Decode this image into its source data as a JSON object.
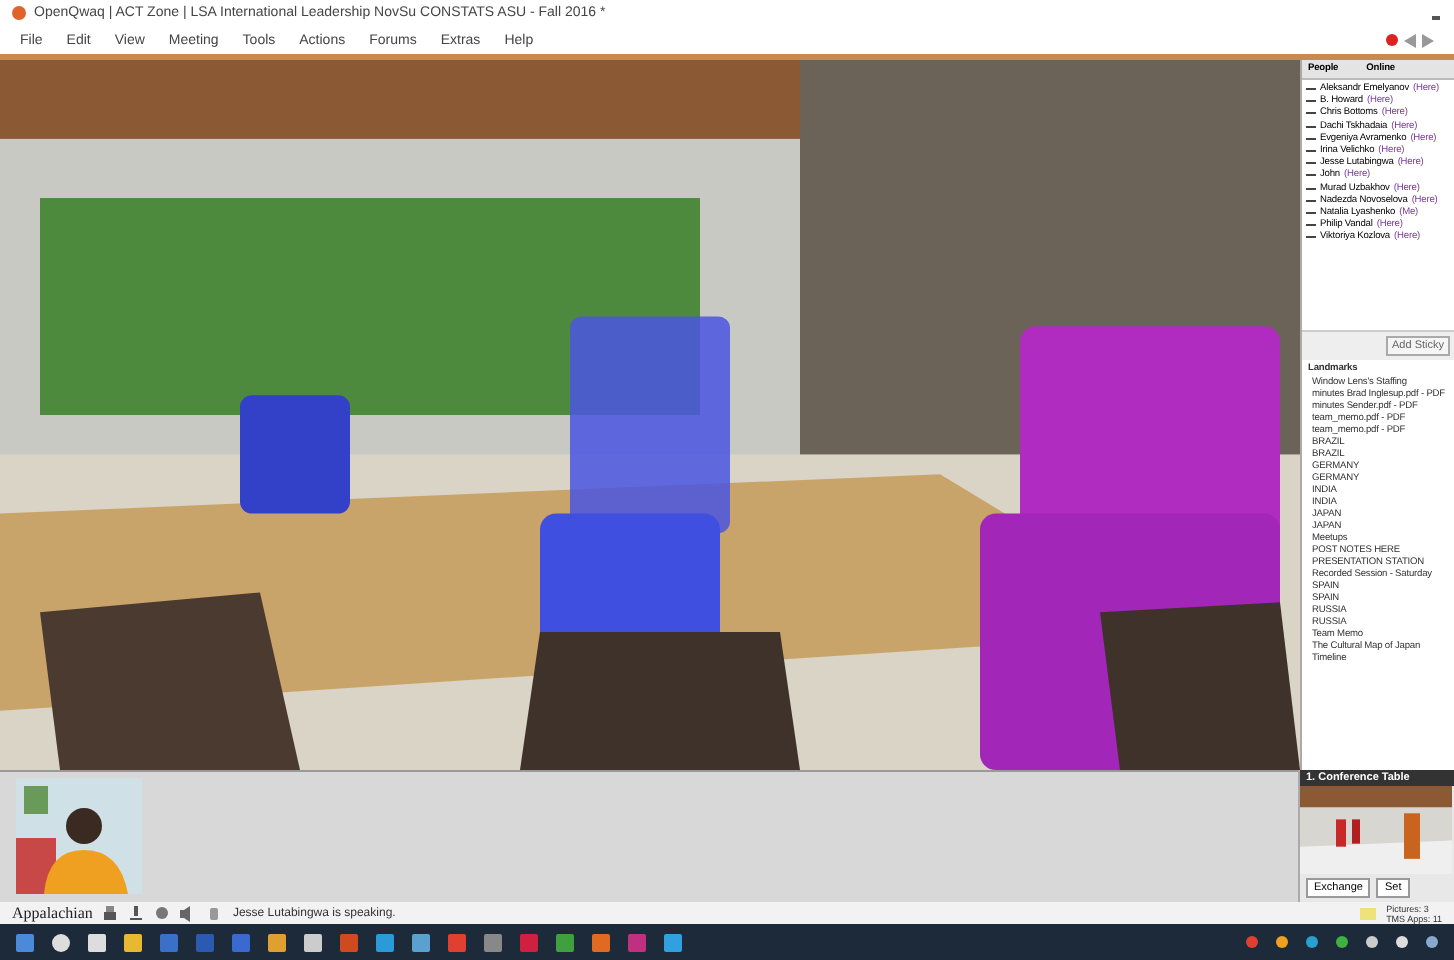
{
  "window": {
    "title": "OpenQwaq | ACT Zone | LSA International Leadership NovSu CONSTATS ASU - Fall 2016 *"
  },
  "menu": [
    "File",
    "Edit",
    "View",
    "Meeting",
    "Tools",
    "Actions",
    "Forums",
    "Extras",
    "Help"
  ],
  "people": {
    "columns": [
      "People",
      "Online"
    ],
    "members": [
      {
        "name": "Aleksandr Emelyanov",
        "status": "(Here)"
      },
      {
        "name": "B. Howard",
        "status": "(Here)"
      },
      {
        "name": "Chris Bottoms",
        "status": "(Here)"
      },
      {
        "name": "Dachi Tskhadaia",
        "status": "(Here)"
      },
      {
        "name": "Evgeniya Avramenko",
        "status": "(Here)"
      },
      {
        "name": "Irina Velichko",
        "status": "(Here)"
      },
      {
        "name": "Jesse Lutabingwa",
        "status": "(Here)"
      },
      {
        "name": "John",
        "status": "(Here)"
      },
      {
        "name": "Murad Uzbakhov",
        "status": "(Here)"
      },
      {
        "name": "Nadezda Novoselova",
        "status": "(Here)"
      },
      {
        "name": "Natalia Lyashenko",
        "status": "(Me)"
      },
      {
        "name": "Philip Vandal",
        "status": "(Here)"
      },
      {
        "name": "Viktoriya Kozlova",
        "status": "(Here)"
      }
    ],
    "buttons": [
      "Add Sticky"
    ]
  },
  "landmarks": {
    "title": "Landmarks",
    "items": [
      "Window Lens's Staffing",
      "minutes Brad Inglesup.pdf - PDF",
      "minutes Sender.pdf - PDF",
      "team_memo.pdf - PDF",
      "team_memo.pdf - PDF",
      "BRAZIL",
      "BRAZIL",
      "GERMANY",
      "GERMANY",
      "INDIA",
      "INDIA",
      "JAPAN",
      "JAPAN",
      "Meetups",
      "POST NOTES HERE",
      "PRESENTATION STATION",
      "Recorded Session - Saturday",
      "SPAIN",
      "SPAIN",
      "RUSSIA",
      "RUSSIA",
      "Team Memo",
      "The Cultural Map of Japan",
      "Timeline"
    ]
  },
  "minimap": {
    "title": "1. Conference Table",
    "buttons": [
      "Exchange",
      "Set"
    ]
  },
  "speaking": {
    "logo": "Appalachian",
    "message": "Jesse Lutabingwa is speaking."
  },
  "stats": [
    "Pictures: 3",
    "TMS Apps: 11"
  ]
}
